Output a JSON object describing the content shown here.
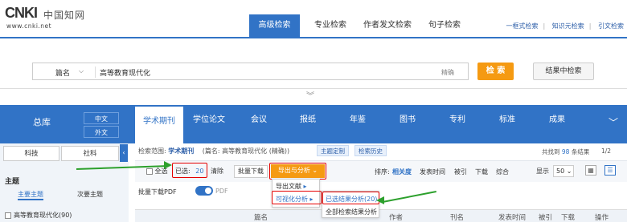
{
  "logo": {
    "brand": "CNKI",
    "cn": "中国知网",
    "url": "www.cnki.net"
  },
  "search_tabs": [
    {
      "label": "高级检索",
      "active": true
    },
    {
      "label": "专业检索",
      "active": false
    },
    {
      "label": "作者发文检索",
      "active": false
    },
    {
      "label": "句子检索",
      "active": false
    }
  ],
  "top_links": [
    "一框式检索",
    "知识元检索",
    "引文检索"
  ],
  "search": {
    "field": "篇名",
    "value": "高等教育现代化",
    "precision": "精确",
    "search_btn": "检 索",
    "inresult_btn": "结果中检索"
  },
  "db": {
    "main": "总库",
    "lang": [
      "中文",
      "外文"
    ],
    "tabs": [
      "学术期刊",
      "学位论文",
      "会议",
      "报纸",
      "年鉴",
      "图书",
      "专利",
      "标准",
      "成果"
    ]
  },
  "left": {
    "tabs": [
      "科技",
      "社科"
    ],
    "section": "主题",
    "subtabs": [
      "主要主题",
      "次要主题"
    ],
    "item": "高等教育现代化(90)"
  },
  "scope": {
    "label": "检索范围:",
    "db": "学术期刊",
    "cond": "(篇名: 高等教育现代化 (精确))",
    "pills": [
      "主题定制",
      "检索历史"
    ]
  },
  "found": {
    "prefix": "共找到",
    "count": "98",
    "suffix": "条结果",
    "pager": "1/2"
  },
  "toolbar": {
    "select_all": "全选",
    "selected_label": "已选:",
    "selected_count": "20",
    "clear": "清除",
    "batch_download": "批量下载",
    "export": "导出与分析",
    "sort_label": "排序:",
    "sorts": [
      "相关度",
      "发表时间",
      "被引",
      "下载",
      "综合"
    ],
    "show_label": "显示",
    "show_value": "50"
  },
  "pdf": {
    "label": "批量下载PDF",
    "toggle_label": "PDF"
  },
  "menu1": [
    "导出文献",
    "可视化分析"
  ],
  "menu2": [
    "已选结果分析(20)",
    "全部检索结果分析"
  ],
  "columns": [
    "篇名",
    "作者",
    "刊名",
    "发表时间",
    "被引",
    "下载",
    "操作"
  ],
  "colors": {
    "primary": "#3173c6",
    "orange": "#f59a12",
    "red_box": "#e60000",
    "green_arrow": "#2ca02c"
  }
}
